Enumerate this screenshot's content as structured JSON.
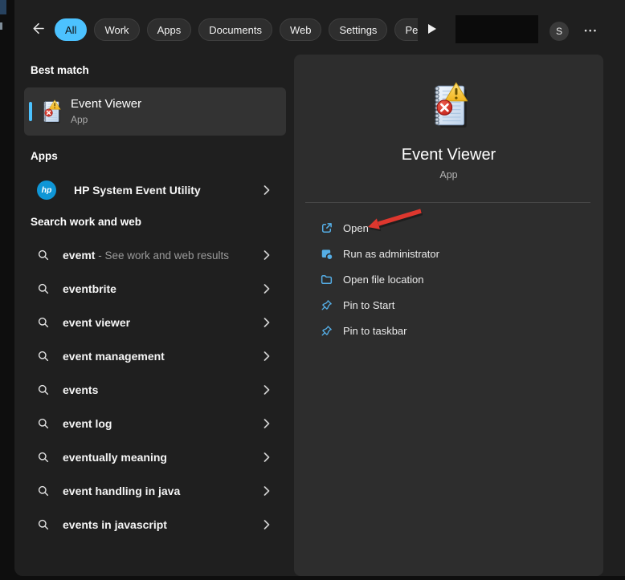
{
  "topbar": {
    "filters": [
      {
        "label": "All",
        "selected": true
      },
      {
        "label": "Work",
        "selected": false
      },
      {
        "label": "Apps",
        "selected": false
      },
      {
        "label": "Documents",
        "selected": false
      },
      {
        "label": "Web",
        "selected": false
      },
      {
        "label": "Settings",
        "selected": false
      },
      {
        "label": "Peop",
        "selected": false
      }
    ],
    "avatar_letter": "S",
    "more_label": "•••"
  },
  "left_panel": {
    "best_match_heading": "Best match",
    "best_match": {
      "title": "Event Viewer",
      "subtitle": "App"
    },
    "apps_heading": "Apps",
    "apps": [
      {
        "label": "HP System Event Utility",
        "badge": "hp"
      }
    ],
    "search_heading": "Search work and web",
    "suggestions": [
      {
        "query": "evemt",
        "suffix": " - See work and web results"
      },
      {
        "query": "eventbrite"
      },
      {
        "query": "event viewer"
      },
      {
        "query": "event management"
      },
      {
        "query": "events"
      },
      {
        "query": "event log"
      },
      {
        "query": "eventually meaning"
      },
      {
        "query": "event handling in java"
      },
      {
        "query": "events in javascript"
      }
    ]
  },
  "right_panel": {
    "app_title": "Event Viewer",
    "app_subtitle": "App",
    "actions": [
      {
        "label": "Open",
        "icon": "open-external-icon"
      },
      {
        "label": "Run as administrator",
        "icon": "run-admin-icon"
      },
      {
        "label": "Open file location",
        "icon": "folder-icon"
      },
      {
        "label": "Pin to Start",
        "icon": "pin-icon"
      },
      {
        "label": "Pin to taskbar",
        "icon": "pin-icon"
      }
    ],
    "annotation": {
      "type": "red-arrow",
      "points_to": "Open"
    }
  },
  "colors": {
    "accent_blue": "#4cc2ff",
    "action_icon_blue": "#55aee6",
    "annotation_red": "#de372e",
    "hp_badge_blue": "#0f96d6",
    "window_bg": "#1f1f1f",
    "card_bg": "#2d2d2d",
    "selected_row_bg": "#333333"
  }
}
